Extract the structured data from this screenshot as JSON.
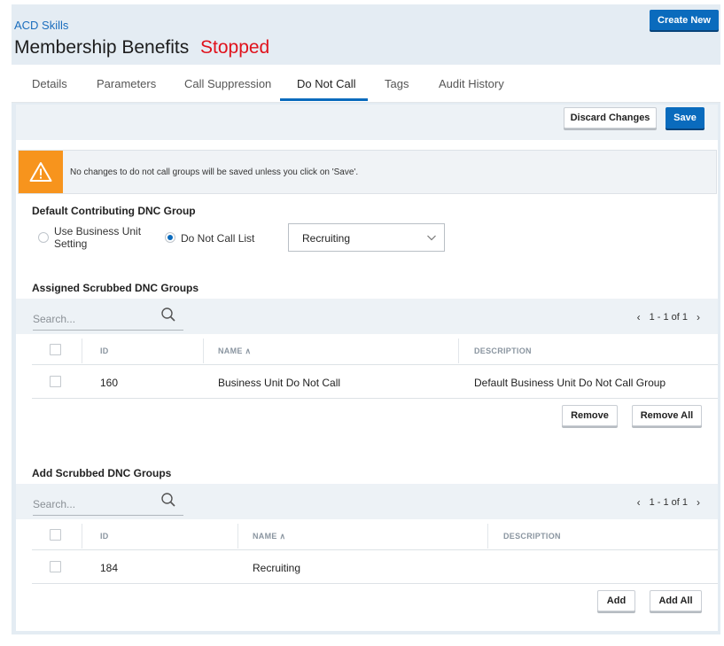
{
  "header": {
    "breadcrumb": "ACD Skills",
    "title": "Membership Benefits",
    "status": "Stopped",
    "create_new_label": "Create New"
  },
  "tabs": [
    {
      "label": "Details"
    },
    {
      "label": "Parameters"
    },
    {
      "label": "Call Suppression"
    },
    {
      "label": "Do Not Call",
      "active": true
    },
    {
      "label": "Tags"
    },
    {
      "label": "Audit History"
    }
  ],
  "toolbar": {
    "discard_label": "Discard Changes",
    "save_label": "Save"
  },
  "alert": {
    "icon": "warning-icon",
    "text": "No changes to do not call groups will be saved unless you click on 'Save'."
  },
  "default_group": {
    "label": "Default Contributing DNC Group",
    "option_business_unit": "Use Business Unit Setting",
    "option_business_unit_line1": "Use Business Unit",
    "option_business_unit_line2": "Setting",
    "option_dnc_list": "Do Not Call List",
    "selected_option": "Do Not Call List",
    "select_value": "Recruiting"
  },
  "assigned": {
    "label": "Assigned Scrubbed DNC Groups",
    "search_placeholder": "Search...",
    "pager": "1 - 1 of 1",
    "columns": {
      "id": "ID",
      "name": "NAME",
      "description": "DESCRIPTION"
    },
    "rows": [
      {
        "id": "160",
        "name": "Business Unit Do Not Call",
        "description": "Default Business Unit Do Not Call Group"
      }
    ],
    "remove_label": "Remove",
    "remove_all_label": "Remove All"
  },
  "available": {
    "label": "Add Scrubbed DNC Groups",
    "search_placeholder": "Search...",
    "pager": "1 - 1 of 1",
    "columns": {
      "id": "ID",
      "name": "NAME",
      "description": "DESCRIPTION"
    },
    "rows": [
      {
        "id": "184",
        "name": "Recruiting",
        "description": ""
      }
    ],
    "add_label": "Add",
    "add_all_label": "Add All"
  },
  "colors": {
    "accent": "#0a6bbd",
    "status_stopped": "#e0121c",
    "warning": "#f7941d",
    "panel": "#e4ecf3"
  }
}
